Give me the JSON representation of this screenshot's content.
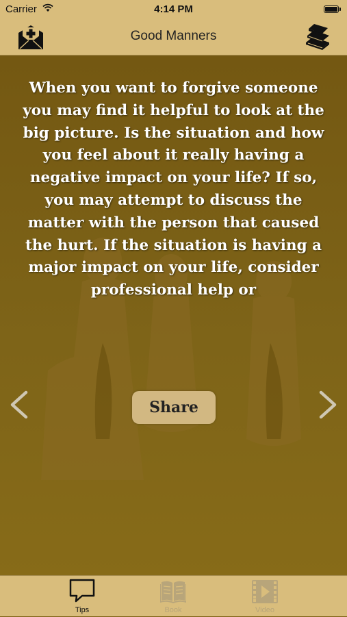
{
  "status_bar": {
    "carrier": "Carrier",
    "time": "4:14 PM",
    "wifi_icon": "wifi-icon",
    "battery_icon": "battery-icon"
  },
  "nav": {
    "title": "Good Manners",
    "left_icon": "mail-add-icon",
    "right_icon": "books-icon"
  },
  "content": {
    "tip_text": "When you want to forgive someone you may find it helpful to look at the big picture. Is the situation and how you feel about it really having a negative impact on your life? If so, you may attempt to discuss the matter with the person that caused the hurt. If the situation is having a major impact on your life, consider professional help or",
    "share_label": "Share",
    "prev_icon": "chevron-left-icon",
    "next_icon": "chevron-right-icon"
  },
  "tabs": [
    {
      "label": "Tips",
      "icon": "speech-bubble-icon",
      "active": true
    },
    {
      "label": "Book",
      "icon": "open-book-icon",
      "active": false
    },
    {
      "label": "Video",
      "icon": "film-icon",
      "active": false
    }
  ],
  "colors": {
    "bar_background": "#d9bd7c",
    "content_background": "#7a5e12",
    "text": "#ffffff",
    "share_button": "#d2b882"
  }
}
